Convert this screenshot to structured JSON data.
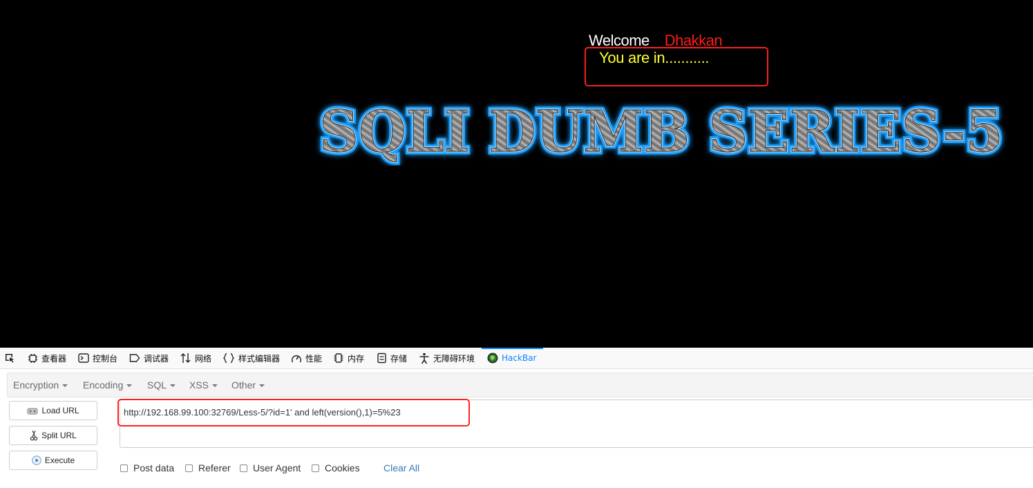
{
  "page": {
    "welcome_label": "Welcome",
    "user_name": "Dhakkan",
    "status_text": "You are in...........",
    "title": "SQLI DUMB SERIES-5"
  },
  "devtools": {
    "tabs": [
      {
        "label": "查看器",
        "icon": "inspector-icon"
      },
      {
        "label": "控制台",
        "icon": "console-icon"
      },
      {
        "label": "调试器",
        "icon": "debugger-icon"
      },
      {
        "label": "网络",
        "icon": "network-icon"
      },
      {
        "label": "样式编辑器",
        "icon": "style-editor-icon"
      },
      {
        "label": "性能",
        "icon": "performance-icon"
      },
      {
        "label": "内存",
        "icon": "memory-icon"
      },
      {
        "label": "存储",
        "icon": "storage-icon"
      },
      {
        "label": "无障碍环境",
        "icon": "accessibility-icon"
      },
      {
        "label": "HackBar",
        "icon": "hackbar-icon"
      }
    ],
    "active_tab": "HackBar"
  },
  "hackbar": {
    "menus": [
      "Encryption",
      "Encoding",
      "SQL",
      "XSS",
      "Other"
    ],
    "buttons": {
      "load_url": "Load URL",
      "split_url": "Split URL",
      "execute": "Execute"
    },
    "url_value": "http://192.168.99.100:32769/Less-5/?id=1' and left(version(),1)=5%23",
    "options": [
      "Post data",
      "Referer",
      "User Agent",
      "Cookies"
    ],
    "clear_all": "Clear All"
  },
  "colors": {
    "page_bg": "#000000",
    "welcome": "#ffffff",
    "user_name": "#ff1a1a",
    "status_text": "#ffff33",
    "highlight_border": "#ff1f1f",
    "title_glow": "#1ea0ff",
    "active_tab": "#0a84ff",
    "link": "#337ab7"
  }
}
